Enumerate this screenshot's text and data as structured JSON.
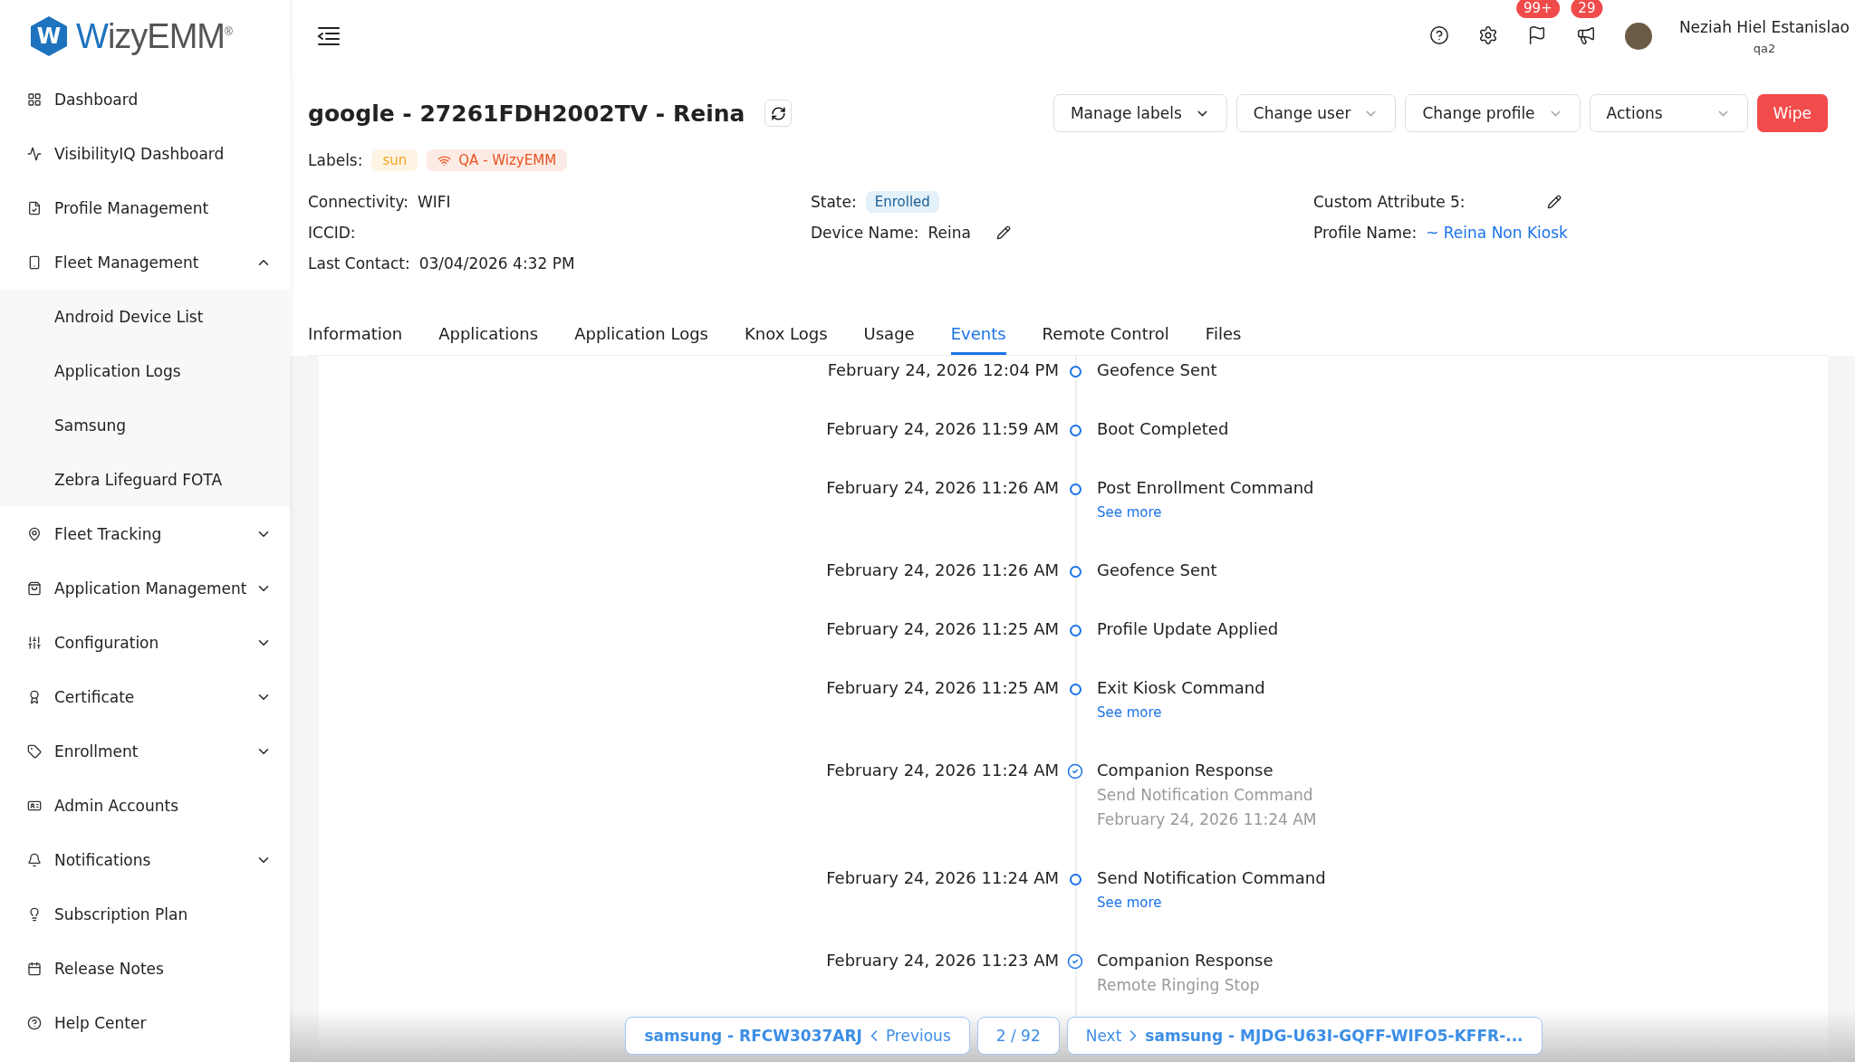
{
  "logo": {
    "mark": "W",
    "name_a": "Wizy",
    "name_b": "EMM",
    "registered": "®"
  },
  "sidebar": {
    "items": [
      {
        "label": "Dashboard"
      },
      {
        "label": "VisibilityIQ Dashboard"
      },
      {
        "label": "Profile Management"
      },
      {
        "label": "Fleet Management",
        "expanded": true,
        "children": [
          {
            "label": "Android Device List"
          },
          {
            "label": "Application Logs"
          },
          {
            "label": "Samsung"
          },
          {
            "label": "Zebra Lifeguard FOTA"
          }
        ]
      },
      {
        "label": "Fleet Tracking",
        "expanded": false
      },
      {
        "label": "Application Management",
        "expanded": false
      },
      {
        "label": "Configuration",
        "expanded": false
      },
      {
        "label": "Certificate",
        "expanded": false
      },
      {
        "label": "Enrollment",
        "expanded": false
      },
      {
        "label": "Admin Accounts"
      },
      {
        "label": "Notifications",
        "expanded": false
      },
      {
        "label": "Subscription Plan"
      },
      {
        "label": "Release Notes"
      },
      {
        "label": "Help Center"
      }
    ]
  },
  "header": {
    "badges": [
      "99+",
      "29"
    ],
    "user": {
      "name": "Neziah Hiel Estanislao",
      "role": "qa2"
    }
  },
  "device": {
    "title": "google - 27261FDH2002TV - Reina",
    "buttons": [
      {
        "label": "Manage labels",
        "kind": "dropdown"
      },
      {
        "label": "Change user",
        "kind": "dropdown"
      },
      {
        "label": "Change profile",
        "kind": "dropdown"
      },
      {
        "label": "Actions",
        "kind": "dropdown"
      },
      {
        "label": "Wipe",
        "kind": "danger"
      }
    ],
    "labels_caption": "Labels:",
    "labels": [
      {
        "text": "sun",
        "color": "#f5a623",
        "wifi": false
      },
      {
        "text": "QA - WizyEMM",
        "color": "#e8531f",
        "wifi": true
      }
    ],
    "columns": [
      [
        {
          "label": "Connectivity:",
          "value": "WIFI"
        },
        {
          "label": "ICCID:"
        },
        {
          "label": "Last Contact:",
          "value": "03/04/2026 4:32 PM"
        }
      ],
      [
        {
          "label": "State:",
          "value": "Enrolled",
          "kind": "badge"
        },
        {
          "label": "Device Name:",
          "value": "Reina",
          "editable": true
        }
      ],
      [
        {
          "label": "Custom Attribute 5:",
          "editable": true
        },
        {
          "label": "Profile Name:",
          "value": "~ Reina Non Kiosk",
          "kind": "link"
        }
      ]
    ]
  },
  "tabs": [
    {
      "label": "Information",
      "selected": false
    },
    {
      "label": "Applications",
      "selected": false
    },
    {
      "label": "Application Logs",
      "selected": false
    },
    {
      "label": "Knox Logs",
      "selected": false
    },
    {
      "label": "Usage",
      "selected": false
    },
    {
      "label": "Events",
      "selected": true
    },
    {
      "label": "Remote Control",
      "selected": false
    },
    {
      "label": "Files",
      "selected": false
    }
  ],
  "events": [
    {
      "time": "February 24, 2026 12:04 PM",
      "kind": "dot",
      "title": "Geofence Sent"
    },
    {
      "time": "February 24, 2026 11:59 AM",
      "kind": "dot",
      "title": "Boot Completed"
    },
    {
      "time": "February 24, 2026 11:26 AM",
      "kind": "dot",
      "title": "Post Enrollment Command",
      "link": "See more"
    },
    {
      "time": "February 24, 2026 11:26 AM",
      "kind": "dot",
      "title": "Geofence Sent"
    },
    {
      "time": "February 24, 2026 11:25 AM",
      "kind": "dot",
      "title": "Profile Update Applied"
    },
    {
      "time": "February 24, 2026 11:25 AM",
      "kind": "dot",
      "title": "Exit Kiosk Command",
      "link": "See more"
    },
    {
      "time": "February 24, 2026 11:24 AM",
      "kind": "check",
      "title": "Companion Response",
      "details": [
        "Send Notification Command",
        "February 24, 2026 11:24 AM"
      ]
    },
    {
      "time": "February 24, 2026 11:24 AM",
      "kind": "dot",
      "title": "Send Notification Command",
      "link": "See more"
    },
    {
      "time": "February 24, 2026 11:23 AM",
      "kind": "check",
      "title": "Companion Response",
      "details": [
        "Remote Ringing Stop"
      ]
    }
  ],
  "pager": {
    "previous": {
      "device": "samsung - RFCW3037ARJ",
      "label": "Previous"
    },
    "position": "2 / 92",
    "next": {
      "label": "Next",
      "device": "samsung - MJDG-U63I-GQFF-WIFO5-KFFR-..."
    }
  }
}
